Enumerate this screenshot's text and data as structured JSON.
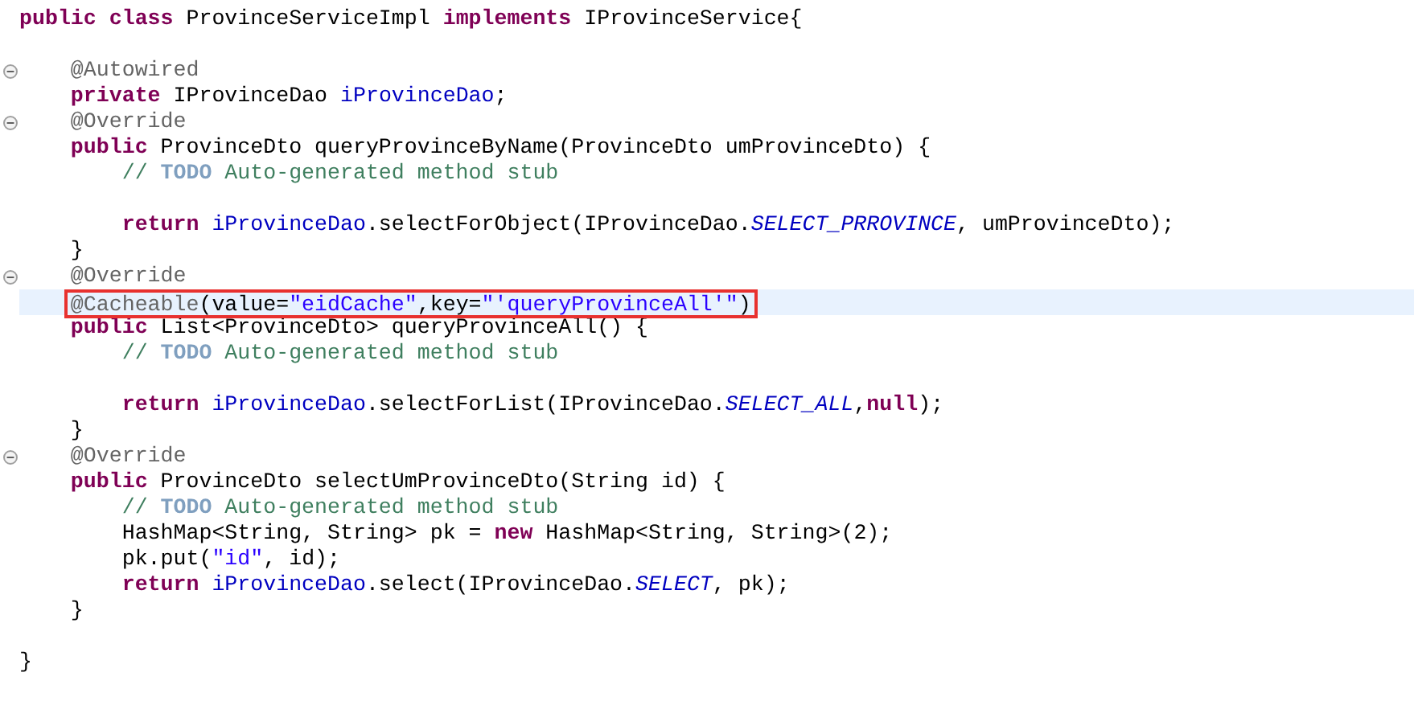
{
  "blocks": [
    {
      "lines": [
        {
          "fold": false,
          "current": false,
          "boxed": false,
          "tokens": [
            {
              "kind": "keyword",
              "text": "public class"
            },
            {
              "kind": "plain",
              "text": " ProvinceServiceImpl "
            },
            {
              "kind": "keyword",
              "text": "implements"
            },
            {
              "kind": "plain",
              "text": " IProvinceService{"
            }
          ]
        }
      ]
    },
    {
      "lines": [
        {
          "fold": true,
          "current": false,
          "boxed": false,
          "tokens": [
            {
              "kind": "annotation",
              "text": "    @Autowired"
            }
          ]
        },
        {
          "fold": false,
          "current": false,
          "boxed": false,
          "tokens": [
            {
              "kind": "keyword",
              "text": "    private"
            },
            {
              "kind": "plain",
              "text": " IProvinceDao "
            },
            {
              "kind": "field",
              "text": "iProvinceDao"
            },
            {
              "kind": "plain",
              "text": ";"
            }
          ]
        },
        {
          "fold": true,
          "current": false,
          "boxed": false,
          "tokens": [
            {
              "kind": "annotation",
              "text": "    @Override"
            }
          ]
        },
        {
          "fold": false,
          "current": false,
          "boxed": false,
          "tokens": [
            {
              "kind": "keyword",
              "text": "    public"
            },
            {
              "kind": "plain",
              "text": " ProvinceDto queryProvinceByName(ProvinceDto umProvinceDto) {"
            }
          ]
        },
        {
          "fold": false,
          "current": false,
          "boxed": false,
          "tokens": [
            {
              "kind": "comment",
              "text": "        // "
            },
            {
              "kind": "todo",
              "text": "TODO"
            },
            {
              "kind": "comment",
              "text": " Auto-generated method stub"
            }
          ]
        }
      ]
    },
    {
      "lines": [
        {
          "fold": false,
          "current": false,
          "boxed": false,
          "tokens": [
            {
              "kind": "keyword",
              "text": "        return"
            },
            {
              "kind": "field",
              "text": " iProvinceDao"
            },
            {
              "kind": "plain",
              "text": ".selectForObject(IProvinceDao."
            },
            {
              "kind": "constant",
              "text": "SELECT_PRROVINCE"
            },
            {
              "kind": "plain",
              "text": ", umProvinceDto);"
            }
          ]
        },
        {
          "fold": false,
          "current": false,
          "boxed": false,
          "tokens": [
            {
              "kind": "plain",
              "text": "    }"
            }
          ]
        },
        {
          "fold": true,
          "current": false,
          "boxed": false,
          "tokens": [
            {
              "kind": "annotation",
              "text": "    @Override"
            }
          ]
        },
        {
          "fold": false,
          "current": true,
          "boxed": true,
          "tokens": [
            {
              "kind": "annotation",
              "text": "    @Cacheable"
            },
            {
              "kind": "plain",
              "text": "(value="
            },
            {
              "kind": "string",
              "text": "\"eidCache\""
            },
            {
              "kind": "plain",
              "text": ",key="
            },
            {
              "kind": "string",
              "text": "\"'queryProvinceAll'\""
            },
            {
              "kind": "plain",
              "text": ")"
            }
          ]
        },
        {
          "fold": false,
          "current": false,
          "boxed": false,
          "tokens": [
            {
              "kind": "keyword",
              "text": "    public"
            },
            {
              "kind": "plain",
              "text": " List<ProvinceDto> queryProvinceAll() {"
            }
          ]
        },
        {
          "fold": false,
          "current": false,
          "boxed": false,
          "tokens": [
            {
              "kind": "comment",
              "text": "        // "
            },
            {
              "kind": "todo",
              "text": "TODO"
            },
            {
              "kind": "comment",
              "text": " Auto-generated method stub"
            }
          ]
        }
      ]
    },
    {
      "lines": [
        {
          "fold": false,
          "current": false,
          "boxed": false,
          "tokens": [
            {
              "kind": "keyword",
              "text": "        return"
            },
            {
              "kind": "field",
              "text": " iProvinceDao"
            },
            {
              "kind": "plain",
              "text": ".selectForList(IProvinceDao."
            },
            {
              "kind": "constant",
              "text": "SELECT_ALL"
            },
            {
              "kind": "plain",
              "text": ","
            },
            {
              "kind": "keyword",
              "text": "null"
            },
            {
              "kind": "plain",
              "text": ");"
            }
          ]
        },
        {
          "fold": false,
          "current": false,
          "boxed": false,
          "tokens": [
            {
              "kind": "plain",
              "text": "    }"
            }
          ]
        },
        {
          "fold": true,
          "current": false,
          "boxed": false,
          "tokens": [
            {
              "kind": "annotation",
              "text": "    @Override"
            }
          ]
        },
        {
          "fold": false,
          "current": false,
          "boxed": false,
          "tokens": [
            {
              "kind": "keyword",
              "text": "    public"
            },
            {
              "kind": "plain",
              "text": " ProvinceDto selectUmProvinceDto(String id) {"
            }
          ]
        },
        {
          "fold": false,
          "current": false,
          "boxed": false,
          "tokens": [
            {
              "kind": "comment",
              "text": "        // "
            },
            {
              "kind": "todo",
              "text": "TODO"
            },
            {
              "kind": "comment",
              "text": " Auto-generated method stub"
            }
          ]
        },
        {
          "fold": false,
          "current": false,
          "boxed": false,
          "tokens": [
            {
              "kind": "plain",
              "text": "        HashMap<String, String> pk = "
            },
            {
              "kind": "keyword",
              "text": "new"
            },
            {
              "kind": "plain",
              "text": " HashMap<String, String>(2);"
            }
          ]
        },
        {
          "fold": false,
          "current": false,
          "boxed": false,
          "tokens": [
            {
              "kind": "plain",
              "text": "        pk.put("
            },
            {
              "kind": "string",
              "text": "\"id\""
            },
            {
              "kind": "plain",
              "text": ", id);"
            }
          ]
        },
        {
          "fold": false,
          "current": false,
          "boxed": false,
          "tokens": [
            {
              "kind": "keyword",
              "text": "        return"
            },
            {
              "kind": "field",
              "text": " iProvinceDao"
            },
            {
              "kind": "plain",
              "text": ".select(IProvinceDao."
            },
            {
              "kind": "constant",
              "text": "SELECT"
            },
            {
              "kind": "plain",
              "text": ", pk);"
            }
          ]
        },
        {
          "fold": false,
          "current": false,
          "boxed": false,
          "tokens": [
            {
              "kind": "plain",
              "text": "    }"
            }
          ]
        }
      ]
    },
    {
      "lines": [
        {
          "fold": false,
          "current": false,
          "boxed": false,
          "tokens": [
            {
              "kind": "plain",
              "text": "}"
            }
          ]
        }
      ]
    }
  ]
}
